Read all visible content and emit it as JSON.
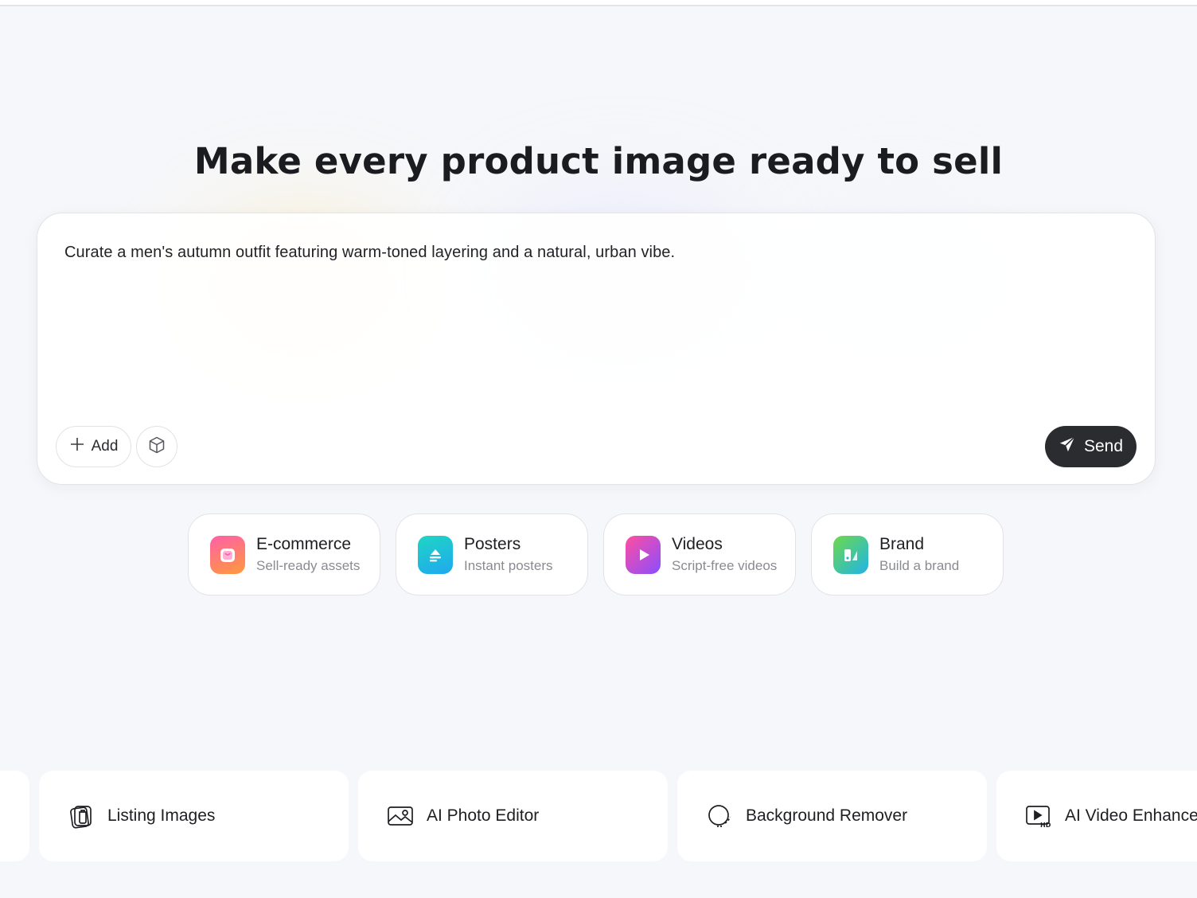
{
  "hero": {
    "headline": "Make every product image ready to sell"
  },
  "prompt": {
    "text": "Curate a men's autumn outfit featuring warm-toned layering and a natural, urban vibe.",
    "add_label": "Add",
    "send_label": "Send",
    "icons": {
      "add": "plus-icon",
      "model": "cube-icon",
      "send": "paper-plane-icon"
    }
  },
  "modes": [
    {
      "title": "E-commerce",
      "subtitle": "Sell-ready assets",
      "icon": "shopping-bag-icon",
      "colors": [
        "#ff5fa8",
        "#ff9a3c"
      ]
    },
    {
      "title": "Posters",
      "subtitle": "Instant posters",
      "icon": "poster-icon",
      "colors": [
        "#1fd6c3",
        "#1fa8f0"
      ]
    },
    {
      "title": "Videos",
      "subtitle": "Script-free videos",
      "icon": "play-icon",
      "colors": [
        "#ff4fa0",
        "#8a4dff"
      ]
    },
    {
      "title": "Brand",
      "subtitle": "Build a brand",
      "icon": "brand-icon",
      "colors": [
        "#6fd94a",
        "#1fb4e8"
      ]
    }
  ],
  "tools": [
    {
      "label": "",
      "icon": ""
    },
    {
      "label": "Listing Images",
      "icon": "listing-images-icon"
    },
    {
      "label": "AI Photo Editor",
      "icon": "photo-editor-icon"
    },
    {
      "label": "Background Remover",
      "icon": "background-remover-icon"
    },
    {
      "label": "AI Video Enhancer",
      "icon": "video-hd-icon"
    }
  ],
  "colors": {
    "page_bg": "#f6f7fa",
    "card_bg": "#ffffff",
    "send_bg": "#2b2c30",
    "text_primary": "#1c1d21",
    "text_secondary": "#8a8b92"
  }
}
